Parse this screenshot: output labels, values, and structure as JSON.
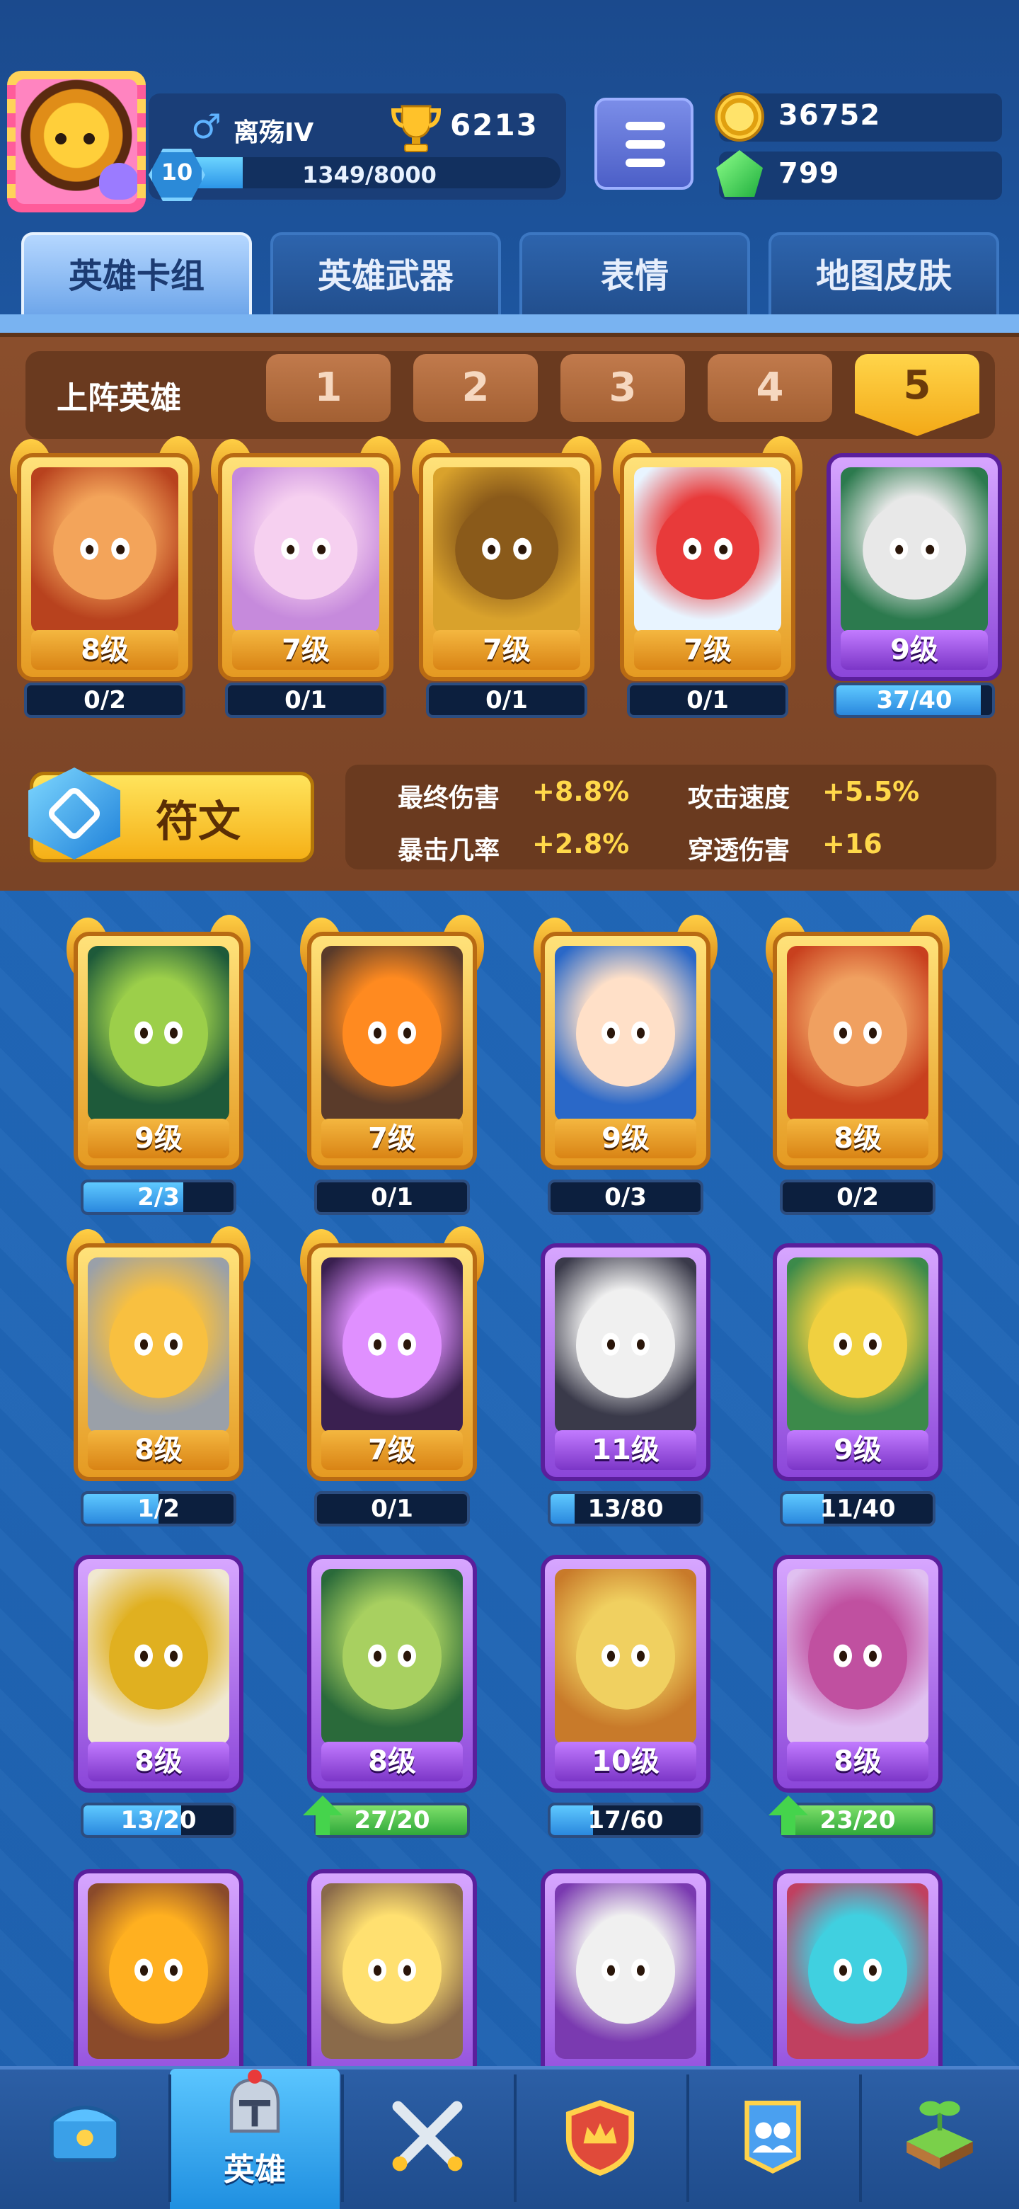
{
  "player": {
    "name": "离殇IV",
    "trophies": "6213",
    "level": "10",
    "xp_text": "1349/8000",
    "xp_fraction": 0.169
  },
  "currency": {
    "coins": "36752",
    "gems": "799"
  },
  "tabs": [
    {
      "label": "英雄卡组",
      "active": true
    },
    {
      "label": "英雄武器",
      "active": false
    },
    {
      "label": "表情",
      "active": false
    },
    {
      "label": "地图皮肤",
      "active": false
    }
  ],
  "lineup": {
    "title": "上阵英雄",
    "slots": [
      "1",
      "2",
      "3",
      "4",
      "5"
    ],
    "active_slot": "5",
    "heroes": [
      {
        "level": "8级",
        "progress": "0/2",
        "fraction": 0,
        "rarity": "gold"
      },
      {
        "level": "7级",
        "progress": "0/1",
        "fraction": 0,
        "rarity": "gold"
      },
      {
        "level": "7级",
        "progress": "0/1",
        "fraction": 0,
        "rarity": "gold"
      },
      {
        "level": "7级",
        "progress": "0/1",
        "fraction": 0,
        "rarity": "gold"
      },
      {
        "level": "9级",
        "progress": "37/40",
        "fraction": 0.925,
        "rarity": "purple"
      }
    ]
  },
  "rune": {
    "label": "符文",
    "stats": [
      {
        "name": "最终伤害",
        "value": "+8.8%"
      },
      {
        "name": "攻击速度",
        "value": "+5.5%"
      },
      {
        "name": "暴击几率",
        "value": "+2.8%"
      },
      {
        "name": "穿透伤害",
        "value": "+16"
      }
    ]
  },
  "collection": [
    {
      "level": "9级",
      "progress": "2/3",
      "fraction": 0.667,
      "rarity": "gold",
      "upgrade": false
    },
    {
      "level": "7级",
      "progress": "0/1",
      "fraction": 0,
      "rarity": "gold",
      "upgrade": false
    },
    {
      "level": "9级",
      "progress": "0/3",
      "fraction": 0,
      "rarity": "gold",
      "upgrade": false
    },
    {
      "level": "8级",
      "progress": "0/2",
      "fraction": 0,
      "rarity": "gold",
      "upgrade": false
    },
    {
      "level": "8级",
      "progress": "1/2",
      "fraction": 0.5,
      "rarity": "gold",
      "upgrade": false
    },
    {
      "level": "7级",
      "progress": "0/1",
      "fraction": 0,
      "rarity": "gold",
      "upgrade": false
    },
    {
      "level": "11级",
      "progress": "13/80",
      "fraction": 0.1625,
      "rarity": "purple",
      "upgrade": false
    },
    {
      "level": "9级",
      "progress": "11/40",
      "fraction": 0.275,
      "rarity": "purple",
      "upgrade": false
    },
    {
      "level": "8级",
      "progress": "13/20",
      "fraction": 0.65,
      "rarity": "purple",
      "upgrade": false
    },
    {
      "level": "8级",
      "progress": "27/20",
      "fraction": 1,
      "rarity": "purple",
      "upgrade": true
    },
    {
      "level": "10级",
      "progress": "17/60",
      "fraction": 0.283,
      "rarity": "purple",
      "upgrade": false
    },
    {
      "level": "8级",
      "progress": "23/20",
      "fraction": 1,
      "rarity": "purple",
      "upgrade": true
    },
    {
      "level": "",
      "progress": "",
      "fraction": 0,
      "rarity": "purple",
      "upgrade": false
    },
    {
      "level": "",
      "progress": "",
      "fraction": 0,
      "rarity": "purple",
      "upgrade": false
    },
    {
      "level": "",
      "progress": "",
      "fraction": 0,
      "rarity": "purple",
      "upgrade": false
    },
    {
      "level": "",
      "progress": "",
      "fraction": 0,
      "rarity": "purple",
      "upgrade": false
    }
  ],
  "nav": {
    "items": [
      {
        "icon": "treasure-chest-icon",
        "label": ""
      },
      {
        "icon": "knight-helmet-icon",
        "label": "英雄",
        "active": true
      },
      {
        "icon": "crossed-swords-icon",
        "label": ""
      },
      {
        "icon": "crown-shield-icon",
        "label": ""
      },
      {
        "icon": "team-banner-icon",
        "label": ""
      },
      {
        "icon": "garden-island-icon",
        "label": ""
      }
    ]
  },
  "colors": {
    "gold_frame": "#e59a22",
    "purple_frame": "#8b46d9",
    "stat_value": "#ffd84a",
    "progress_fill": "#2a88de",
    "upgrade_fill": "#2fa83a"
  }
}
